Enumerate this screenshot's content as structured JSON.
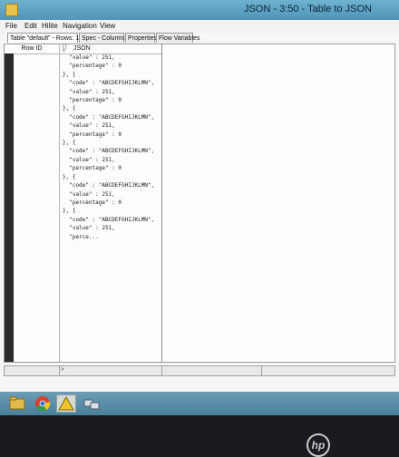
{
  "window": {
    "title": "JSON - 3:50 - Table to JSON"
  },
  "menu": [
    "File",
    "Edit",
    "Hilite",
    "Navigation",
    "View"
  ],
  "tabs": [
    {
      "label": "Table \"default\" - Rows: 1",
      "active": true
    },
    {
      "label": "Spec - Column: 1",
      "active": false
    },
    {
      "label": "Properties",
      "active": false
    },
    {
      "label": "Flow Variables",
      "active": false
    }
  ],
  "table": {
    "row_id_header": "Row ID",
    "column_header": "JSON",
    "column_type_icon": "json-type-icon",
    "json_lines": [
      "  \"value\" : 251,",
      "  \"percentage\" : 0",
      "}, {",
      "  \"code\" : \"ABCDEFGHIJKLMN\",",
      "  \"value\" : 251,",
      "  \"percentage\" : 0",
      "}, {",
      "  \"code\" : \"ABCDEFGHIJKLMN\",",
      "  \"value\" : 251,",
      "  \"percentage\" : 0",
      "}, {",
      "  \"code\" : \"ABCDEFGHIJKLMN\",",
      "  \"value\" : 251,",
      "  \"percentage\" : 0",
      "}, {",
      "  \"code\" : \"ABCDEFGHIJKLMN\",",
      "  \"value\" : 251,",
      "  \"percentage\" : 0",
      "}, {",
      "  \"code\" : \"ABCDEFGHIJKLMN\",",
      "  \"value\" : 251,",
      "  \"perce..."
    ]
  },
  "taskbar": {
    "items": [
      "file-explorer-icon",
      "chrome-icon",
      "knime-icon",
      "network-icon"
    ]
  },
  "brand": "hp"
}
